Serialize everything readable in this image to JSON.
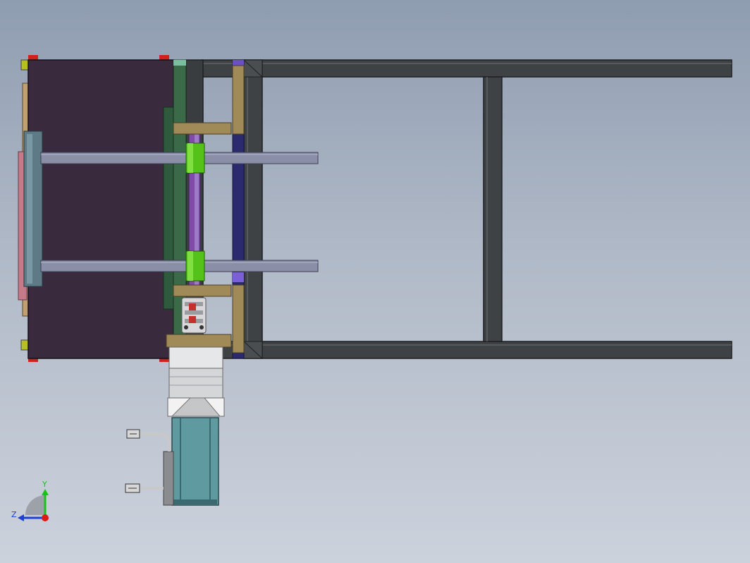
{
  "viewport": {
    "background_top": "#8f9db1",
    "background_bottom": "#ccd2dc"
  },
  "triad": {
    "y_label": "Y",
    "z_label": "Z",
    "y_color": "#19c219",
    "z_color": "#1f3fd6",
    "x_color": "#e01818"
  },
  "colors": {
    "frame_steel": "#3f4244",
    "frame_edge": "#1e2022",
    "plate_dark": "#3a2a3e",
    "gusset_tan": "#a08a58",
    "block_green": "#55c21a",
    "guide_rod": "#8a8ea6",
    "motor_teal": "#5f9aa0",
    "gearbox_silver": "#d4d6d8",
    "cable_gray": "#c8c8c8"
  },
  "components": {
    "left_plate": "plate-dark",
    "guide_rods": 2,
    "slider_blocks": 2,
    "gussets": 3,
    "coupling": "coupling",
    "servo_motor": "servo-motor",
    "cables": 2
  }
}
